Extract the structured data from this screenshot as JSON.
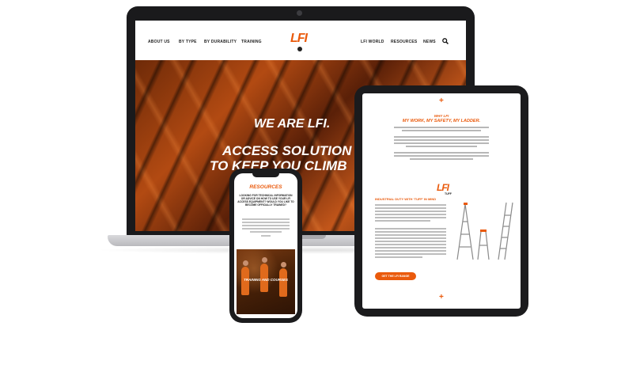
{
  "laptop": {
    "nav": {
      "about": "ABOUT US",
      "by_type": "BY TYPE",
      "by_durability": "BY DURABILITY",
      "training": "TRAINING",
      "lfi_world": "LFI WORLD",
      "resources": "RESOURCES",
      "news": "NEWS"
    },
    "logo": "LFI",
    "hero": {
      "line1": "WE ARE LFI.",
      "line2": "ACCESS SOLUTION",
      "line3": "TO KEEP YOU CLIMB"
    }
  },
  "tablet": {
    "kicker": "WHY LFI",
    "headline": "MY WORK, MY SAFETY, MY LADDER.",
    "logo": "LFI",
    "logo_sub": "TUFF",
    "section_title": "INDUSTRIAL DUTY WITH ‘TUFF’ IN MIND",
    "button": "GET THE LFI RANGE"
  },
  "phone": {
    "title": "RESOURCES",
    "text": "LOOKING FOR TECHNICAL INFORMATION OR ADVICE ON HOW TO USE YOUR LFI ACCESS EQUIPMENT? WOULD YOU LIKE TO BECOME OFFICIALLY TRAINED?",
    "caption": "TRAINING AND COURSES"
  },
  "colors": {
    "brand_orange": "#ea5a0c",
    "device_dark": "#1b1b1d"
  },
  "icons": [
    "search-icon",
    "plus-icon",
    "ladder-icon"
  ]
}
